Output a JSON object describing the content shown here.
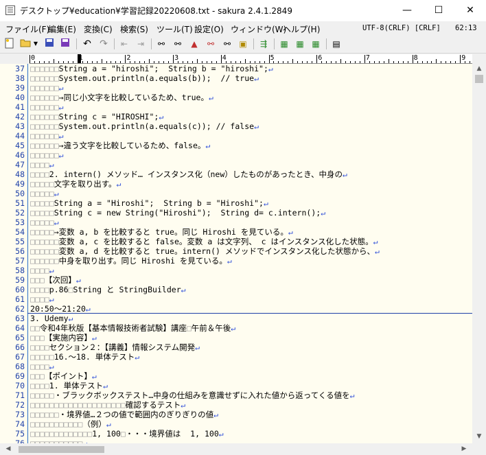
{
  "window": {
    "title": "デスクトップ¥education¥学習記録20220608.txt - sakura 2.4.1.2849",
    "minimize": "—",
    "maximize": "☐",
    "close": "✕"
  },
  "menu": {
    "items": [
      "ファイル(F)",
      "編集(E)",
      "変換(C)",
      "検索(S)",
      "ツール(T)",
      "設定(O)",
      "ウィンドウ(W)",
      "ヘルプ(H)"
    ],
    "encoding": "UTF-8(CRLF) [CRLF]",
    "position": "62:13"
  },
  "toolbar": {
    "icons": [
      "new-file-icon",
      "open-folder-icon",
      "dropdown-icon",
      "save-icon",
      "save-all-icon",
      "undo-icon",
      "redo-icon",
      "jump-back-icon",
      "jump-forward-icon",
      "search-prev-icon",
      "search-next-icon",
      "search-box-icon",
      "replace-icon",
      "grep-icon",
      "grep-replace-icon",
      "outline-icon",
      "compare-icon",
      "macro-icon",
      "keymacro-icon",
      "settings-icon"
    ]
  },
  "ruler": {
    "labels": [
      "0",
      "1",
      "2",
      "3",
      "4",
      "5",
      "6",
      "7",
      "8",
      "9"
    ]
  },
  "editor": {
    "lines": [
      {
        "n": "37",
        "t": "□□□□□□String a = \"hiroshi\";  String b = \"hiroshi\";↵"
      },
      {
        "n": "38",
        "t": "□□□□□□System.out.println(a.equals(b));  // true↵"
      },
      {
        "n": "39",
        "t": "□□□□□□↵"
      },
      {
        "n": "40",
        "t": "□□□□□□→同じ小文字を比較しているため、true。↵"
      },
      {
        "n": "41",
        "t": "□□□□□□↵"
      },
      {
        "n": "42",
        "t": "□□□□□□String c = \"HIROSHI\";↵"
      },
      {
        "n": "43",
        "t": "□□□□□□System.out.println(a.equals(c)); // false↵"
      },
      {
        "n": "44",
        "t": "□□□□□□↵"
      },
      {
        "n": "45",
        "t": "□□□□□□→違う文字を比較しているため、false。↵"
      },
      {
        "n": "46",
        "t": "□□□□□□↵"
      },
      {
        "n": "47",
        "t": "□□□□↵"
      },
      {
        "n": "48",
        "t": "□□□□2. intern() メソッド… インスタンス化（new）したものがあったとき、中身の↵"
      },
      {
        "n": "49",
        "t": "□□□□□文字を取り出す。↵"
      },
      {
        "n": "50",
        "t": "□□□□□↵"
      },
      {
        "n": "51",
        "t": "□□□□□String a = \"Hiroshi\";  String b = \"Hiroshi\";↵"
      },
      {
        "n": "52",
        "t": "□□□□□String c = new String(\"Hiroshi\");  String d= c.intern();↵"
      },
      {
        "n": "53",
        "t": "□□□□□↵"
      },
      {
        "n": "54",
        "t": "□□□□□→変数 a, b を比較すると true。同じ Hiroshi を見ている。↵"
      },
      {
        "n": "55",
        "t": "□□□□□□変数 a, c を比較すると false。変数 a は文字列、 c はインスタンス化した状態。↵"
      },
      {
        "n": "56",
        "t": "□□□□□□変数 a, d を比較すると true。intern() メソッドでインスタンス化した状態から、↵"
      },
      {
        "n": "57",
        "t": "□□□□□□中身を取り出す。同じ Hiroshi を見ている。↵"
      },
      {
        "n": "58",
        "t": "□□□□↵"
      },
      {
        "n": "59",
        "t": "□□□【次回】↵"
      },
      {
        "n": "60",
        "t": "□□□□p.86□String と StringBuilder↵"
      },
      {
        "n": "61",
        "t": "□□□□↵"
      },
      {
        "n": "62",
        "t": "20:50〜21:20↵"
      },
      {
        "n": "63",
        "t": "3. Udemy↵"
      },
      {
        "n": "64",
        "t": "□□令和4年秋版【基本情報技術者試験】講座□午前＆午後↵"
      },
      {
        "n": "65",
        "t": "□□□【実施内容】↵"
      },
      {
        "n": "66",
        "t": "□□□□セクション２：【講義】情報システム開発↵"
      },
      {
        "n": "67",
        "t": "□□□□□16.〜18. 単体テスト↵"
      },
      {
        "n": "68",
        "t": "□□□□↵"
      },
      {
        "n": "69",
        "t": "□□□【ポイント】↵"
      },
      {
        "n": "70",
        "t": "□□□□1. 単体テスト↵"
      },
      {
        "n": "71",
        "t": "□□□□□・ブラックボックステスト…中身の仕組みを意識せずに入れた値から返ってくる値を↵"
      },
      {
        "n": "72",
        "t": "□□□□□□□□□□□□□□□□□□□□確認するテスト↵"
      },
      {
        "n": "73",
        "t": "□□□□□□・境界値…２つの値で範囲内のぎりぎりの値↵"
      },
      {
        "n": "74",
        "t": "□□□□□□□□□□□（例）↵"
      },
      {
        "n": "75",
        "t": "□□□□□□□□□□□□□1, 100□・・・境界値は  1, 100↵"
      },
      {
        "n": "76",
        "t": "□□□□□□□□□□□↵"
      }
    ]
  }
}
